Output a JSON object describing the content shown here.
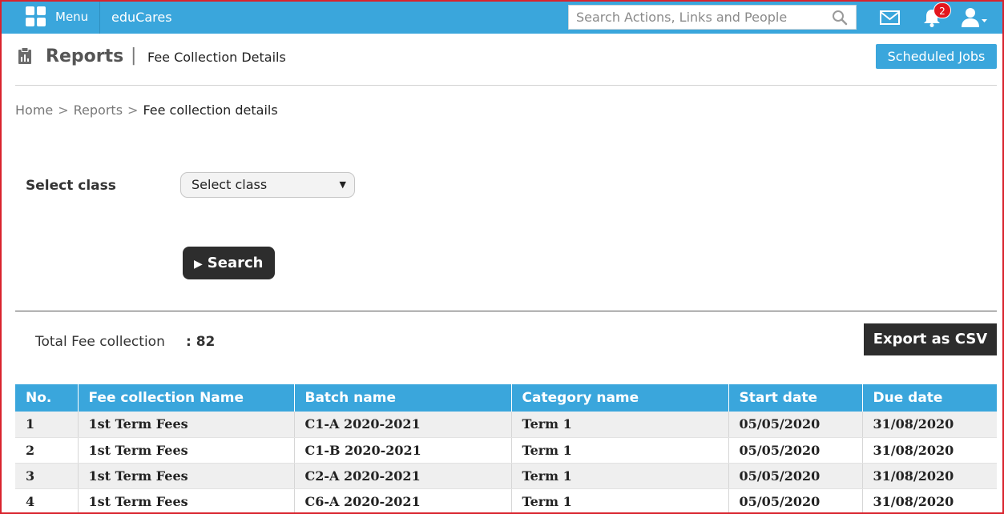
{
  "topbar": {
    "menu_label": "Menu",
    "brand": "eduCares",
    "search_placeholder": "Search Actions, Links and People",
    "notification_count": "2",
    "accent_color": "#3aa6dc"
  },
  "header": {
    "title": "Reports",
    "separator": "|",
    "subtitle": "Fee Collection Details",
    "scheduled_jobs_label": "Scheduled Jobs"
  },
  "breadcrumb": {
    "items": [
      "Home",
      "Reports",
      "Fee collection details"
    ],
    "sep": ">"
  },
  "form": {
    "class_label": "Select class",
    "class_select_value": "Select class",
    "search_label": "Search"
  },
  "summary": {
    "total_label": "Total Fee collection",
    "total_value": ": 82",
    "export_label": "Export as CSV"
  },
  "table": {
    "headers": [
      "No.",
      "Fee collection Name",
      "Batch name",
      "Category name",
      "Start date",
      "Due date"
    ],
    "rows": [
      [
        "1",
        "1st Term Fees",
        "C1-A 2020-2021",
        "Term 1",
        "05/05/2020",
        "31/08/2020"
      ],
      [
        "2",
        "1st Term Fees",
        "C1-B 2020-2021",
        "Term 1",
        "05/05/2020",
        "31/08/2020"
      ],
      [
        "3",
        "1st Term Fees",
        "C2-A 2020-2021",
        "Term 1",
        "05/05/2020",
        "31/08/2020"
      ],
      [
        "4",
        "1st Term Fees",
        "C6-A 2020-2021",
        "Term 1",
        "05/05/2020",
        "31/08/2020"
      ]
    ]
  },
  "icons": {
    "menu": "grid-icon",
    "search": "search-icon",
    "mail": "mail-icon",
    "notifications": "bell-icon",
    "account": "user-icon",
    "reports": "clipboard-icon",
    "search_button": "play-icon"
  }
}
